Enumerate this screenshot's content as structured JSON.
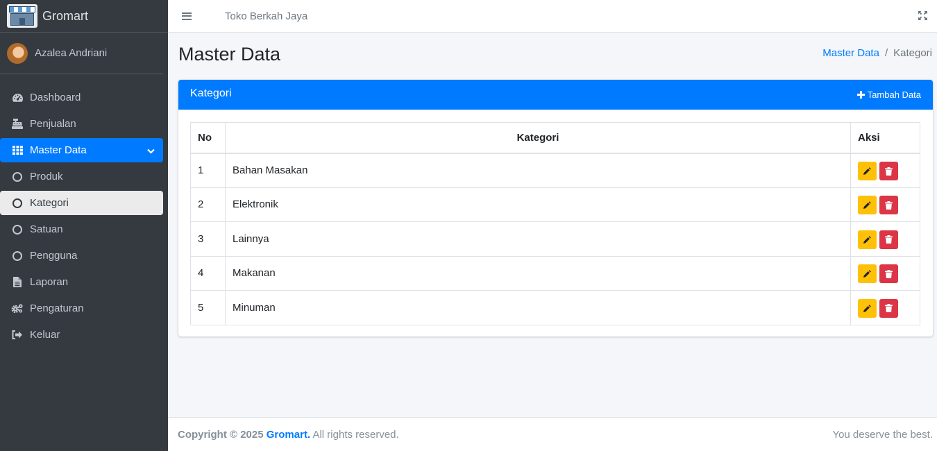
{
  "brand": {
    "name": "Gromart"
  },
  "user": {
    "name": "Azalea Andriani"
  },
  "sidebar": {
    "items": [
      {
        "label": "Dashboard",
        "icon": "tachometer-icon"
      },
      {
        "label": "Penjualan",
        "icon": "cash-register-icon"
      },
      {
        "label": "Master Data",
        "icon": "grid-icon"
      },
      {
        "label": "Produk",
        "icon": "circle-icon"
      },
      {
        "label": "Kategori",
        "icon": "circle-icon"
      },
      {
        "label": "Satuan",
        "icon": "circle-icon"
      },
      {
        "label": "Pengguna",
        "icon": "circle-icon"
      },
      {
        "label": "Laporan",
        "icon": "file-icon"
      },
      {
        "label": "Pengaturan",
        "icon": "cogs-icon"
      },
      {
        "label": "Keluar",
        "icon": "sign-out-icon"
      }
    ]
  },
  "header": {
    "store_name": "Toko Berkah Jaya"
  },
  "page": {
    "title": "Master Data",
    "breadcrumb": {
      "parent": "Master Data",
      "separator": "/",
      "current": "Kategori"
    }
  },
  "card": {
    "title": "Kategori",
    "add_label": "Tambah Data",
    "table": {
      "headers": {
        "no": "No",
        "kategori": "Kategori",
        "aksi": "Aksi"
      },
      "rows": [
        {
          "no": "1",
          "kategori": "Bahan Masakan"
        },
        {
          "no": "2",
          "kategori": "Elektronik"
        },
        {
          "no": "3",
          "kategori": "Lainnya"
        },
        {
          "no": "4",
          "kategori": "Makanan"
        },
        {
          "no": "5",
          "kategori": "Minuman"
        }
      ]
    }
  },
  "footer": {
    "copyright_prefix": "Copyright © 2025",
    "brand_link": "Gromart.",
    "copyright_suffix": "All rights reserved.",
    "tagline": "You deserve the best."
  },
  "colors": {
    "primary": "#007bff",
    "sidebar_bg": "#343a40",
    "edit": "#ffc107",
    "delete": "#dc3545"
  }
}
